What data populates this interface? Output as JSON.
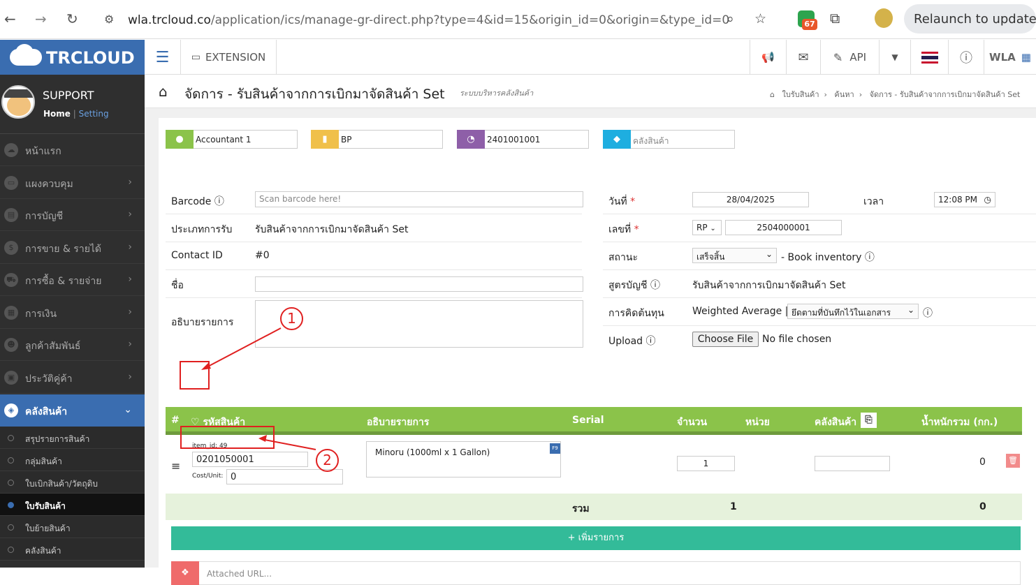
{
  "browser": {
    "host": "wla.trcloud.co",
    "path": "/application/ics/manage-gr-direct.php?type=4&id=15&origin_id=0&origin=&type_id=0",
    "ext_badge": "67",
    "relaunch": "Relaunch to update"
  },
  "topbar": {
    "brand": "TRCLOUD",
    "extension": "EXTENSION",
    "api": "API",
    "user": "WLA"
  },
  "profile": {
    "name": "SUPPORT",
    "home": "Home",
    "sep": "|",
    "setting": "Setting"
  },
  "menu": [
    {
      "label": "หน้าแรก",
      "icon": "cloud-icon"
    },
    {
      "label": "แผงควบคุม",
      "icon": "monitor-icon"
    },
    {
      "label": "การบัญชี",
      "icon": "book-icon"
    },
    {
      "label": "การขาย & รายได้",
      "icon": "dollar-icon"
    },
    {
      "label": "การซื้อ & รายจ่าย",
      "icon": "cart-icon"
    },
    {
      "label": "การเงิน",
      "icon": "calendar-icon"
    },
    {
      "label": "ลูกค้าสัมพันธ์",
      "icon": "users-icon"
    },
    {
      "label": "ประวัติคู่ค้า",
      "icon": "contact-icon"
    }
  ],
  "menu_active": "คลังสินค้า",
  "submenu": [
    "สรุปรายการสินค้า",
    "กลุ่มสินค้า",
    "ใบเบิกสินค้า/วัตถุดิบ",
    "ใบรับสินค้า",
    "ใบย้ายสินค้า",
    "คลังสินค้า"
  ],
  "page": {
    "title": "จัดการ - รับสินค้าจากการเบิกมาจัดสินค้า Set",
    "subtitle": "ระบบบริหารคลังสินค้า",
    "crumbs": [
      "ใบรับสินค้า",
      "ค้นหา",
      "จัดการ - รับสินค้าจากการเบิกมาจัดสินค้า Set"
    ]
  },
  "tags": {
    "user": "Accountant 1",
    "branch": "BP",
    "code": "2401001001",
    "warehouse_ph": "คลังสินค้า"
  },
  "form_left": {
    "barcode_label": "Barcode",
    "barcode_ph": "Scan barcode here!",
    "type_label": "ประเภทการรับ",
    "type_value": "รับสินค้าจากการเบิกมาจัดสินค้า Set",
    "contact_label": "Contact ID",
    "contact_value": "#0",
    "name_label": "ชื่อ",
    "desc_label": "อธิบายรายการ"
  },
  "form_right": {
    "date_label": "วันที่",
    "date_value": "28/04/2025",
    "time_label": "เวลา",
    "time_value": "12:08 PM",
    "no_label": "เลขที่",
    "prefix": "RP",
    "no_value": "2504000001",
    "status_label": "สถานะ",
    "status_value": "เสร็จสิ้น",
    "book_inventory": "- Book inventory",
    "formula_label": "สูตรบัญชี",
    "formula_value": "รับสินค้าจากการเบิกมาจัดสินค้า Set",
    "cost_label": "การคิดต้นทุน",
    "cost_method": "Weighted Average |",
    "cost_option": "ยึดตามที่บันทึกไว้ในเอกสาร",
    "upload_label": "Upload",
    "choose_file": "Choose File",
    "no_file": "No file chosen"
  },
  "table": {
    "headers": [
      "#",
      "รหัสสินค้า",
      "อธิบายรายการ",
      "Serial",
      "จำนวน",
      "หน่วย",
      "คลังสินค้า",
      "น้ำหนักรวม (กก.)"
    ],
    "row": {
      "item_id": "item_id: 49",
      "code": "0201050001",
      "cost_label": "Cost/Unit:",
      "cost_value": "0",
      "description": "Minoru (1000ml x 1 Gallon)",
      "f9": "F9",
      "qty": "1",
      "weight": "0"
    },
    "total_label": "รวม",
    "total_qty": "1",
    "total_weight": "0",
    "add_button": "+ เพิ่มรายการ",
    "attached_ph": "Attached URL..."
  },
  "annotations": [
    "1",
    "2"
  ]
}
